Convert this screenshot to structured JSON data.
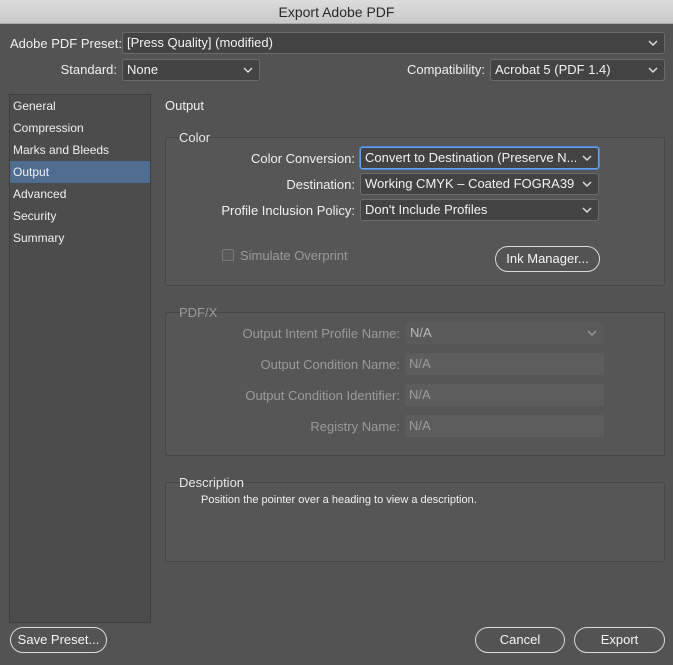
{
  "window": {
    "title": "Export Adobe PDF"
  },
  "header": {
    "preset_label": "Adobe PDF Preset:",
    "preset_value": "[Press Quality] (modified)",
    "standard_label": "Standard:",
    "standard_value": "None",
    "compat_label": "Compatibility:",
    "compat_value": "Acrobat 5 (PDF 1.4)"
  },
  "sidebar": {
    "items": [
      {
        "label": "General"
      },
      {
        "label": "Compression"
      },
      {
        "label": "Marks and Bleeds"
      },
      {
        "label": "Output",
        "selected": true
      },
      {
        "label": "Advanced"
      },
      {
        "label": "Security"
      },
      {
        "label": "Summary"
      }
    ]
  },
  "main": {
    "section_title": "Output",
    "color": {
      "title": "Color",
      "conversion_label": "Color Conversion:",
      "conversion_value": "Convert to Destination (Preserve N...",
      "destination_label": "Destination:",
      "destination_value": "Working CMYK – Coated FOGRA39 ...",
      "profile_label": "Profile Inclusion Policy:",
      "profile_value": "Don't Include Profiles",
      "simulate_label": "Simulate Overprint",
      "ink_manager_label": "Ink Manager..."
    },
    "pdfx": {
      "title": "PDF/X",
      "intent_label": "Output Intent Profile Name:",
      "intent_value": "N/A",
      "condition_name_label": "Output Condition Name:",
      "condition_name_value": "N/A",
      "condition_id_label": "Output Condition Identifier:",
      "condition_id_value": "N/A",
      "registry_label": "Registry Name:",
      "registry_value": "N/A"
    },
    "description": {
      "title": "Description",
      "text": "Position the pointer over a heading to view a description."
    }
  },
  "footer": {
    "save_preset_label": "Save Preset...",
    "cancel_label": "Cancel",
    "export_label": "Export"
  }
}
